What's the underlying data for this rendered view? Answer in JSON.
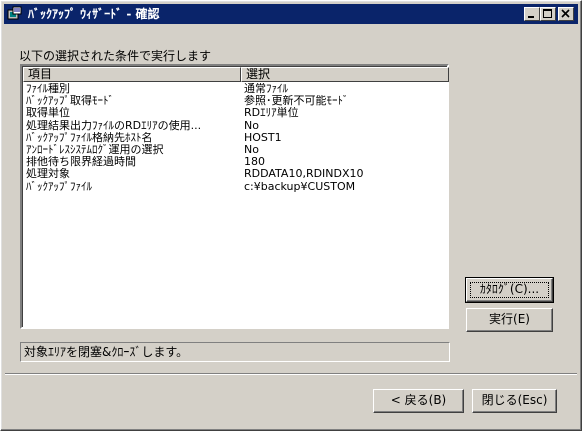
{
  "window": {
    "title": "ﾊﾞｯｸｱｯﾌﾟ ｳｨｻﾞｰﾄﾞ - 確認"
  },
  "main": {
    "section_label": "以下の選択された条件で実行します",
    "list": {
      "headers": [
        "項目",
        "選択"
      ],
      "rows": [
        {
          "item": "ﾌｧｲﾙ種別",
          "value": "通常ﾌｧｲﾙ"
        },
        {
          "item": "ﾊﾞｯｸｱｯﾌﾟ取得ﾓｰﾄﾞ",
          "value": "参照･更新不可能ﾓｰﾄﾞ"
        },
        {
          "item": "取得単位",
          "value": "RDｴﾘｱ単位"
        },
        {
          "item": "処理結果出力ﾌｧｲﾙのRDｴﾘｱの使用...",
          "value": "No"
        },
        {
          "item": "ﾊﾞｯｸｱｯﾌﾟﾌｧｲﾙ格納先ﾎｽﾄ名",
          "value": "HOST1"
        },
        {
          "item": "ｱﾝﾛｰﾄﾞﾚｽｼｽﾃﾑﾛｸﾞ運用の選択",
          "value": "No"
        },
        {
          "item": "排他待ち限界経過時間",
          "value": "180"
        },
        {
          "item": "処理対象",
          "value": "RDDATA10,RDINDX10"
        },
        {
          "item": "ﾊﾞｯｸｱｯﾌﾟﾌｧｲﾙ",
          "value": "c:¥backup¥CUSTOM"
        }
      ]
    },
    "status_text": "対象ｴﾘｱを閉塞&ｸﾛｰｽﾞします。"
  },
  "buttons": {
    "catalog": "ｶﾀﾛｸﾞ(C)...",
    "execute": "実行(E)",
    "back": "< 戻る(B)",
    "close": "閉じる(Esc)"
  }
}
